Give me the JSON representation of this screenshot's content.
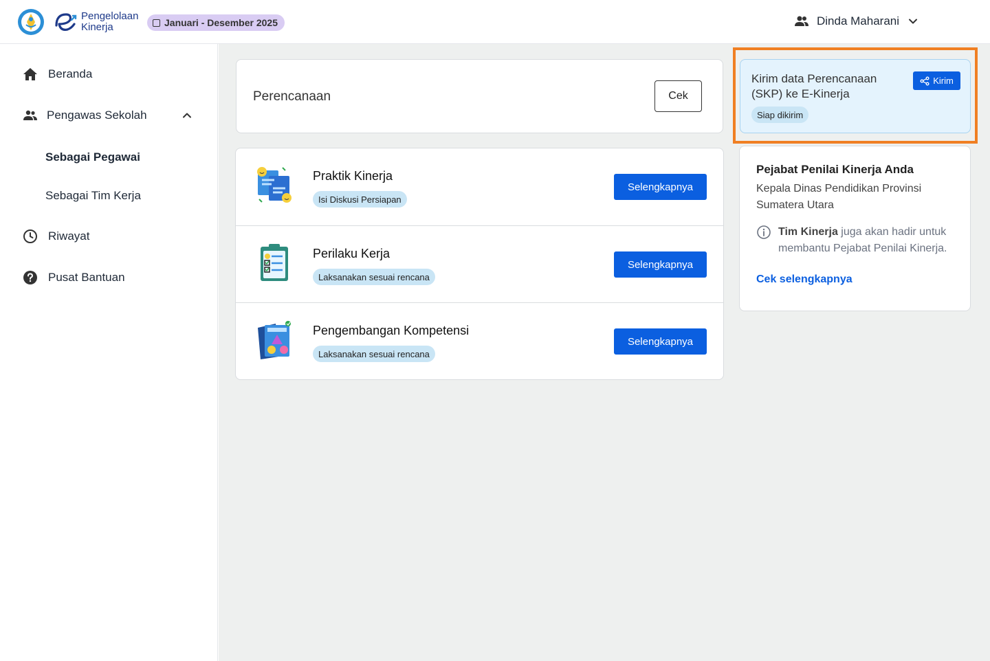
{
  "header": {
    "app_name_line1": "Pengelolaan",
    "app_name_line2": "Kinerja",
    "period": "Januari - Desember 2025",
    "user_name": "Dinda Maharani"
  },
  "sidebar": {
    "items": [
      {
        "label": "Beranda",
        "icon": "home-icon"
      },
      {
        "label": "Pengawas Sekolah",
        "icon": "people-icon",
        "expanded": true
      },
      {
        "label": "Sebagai Pegawai",
        "active": true
      },
      {
        "label": "Sebagai Tim Kerja"
      },
      {
        "label": "Riwayat",
        "icon": "clock-icon"
      },
      {
        "label": "Pusat Bantuan",
        "icon": "help-icon"
      }
    ]
  },
  "planning": {
    "title": "Perencanaan",
    "button": "Cek"
  },
  "activities": [
    {
      "title": "Praktik Kinerja",
      "status": "Isi Diskusi Persiapan",
      "button": "Selengkapnya",
      "icon": "praktik-kinerja-illustration"
    },
    {
      "title": "Perilaku Kerja",
      "status": "Laksanakan sesuai rencana",
      "button": "Selengkapnya",
      "icon": "clipboard-checklist-illustration"
    },
    {
      "title": "Pengembangan Kompetensi",
      "status": "Laksanakan sesuai rencana",
      "button": "Selengkapnya",
      "icon": "competency-book-illustration"
    }
  ],
  "send_card": {
    "title": "Kirim data Perencanaan (SKP) ke E-Kinerja",
    "status": "Siap dikirim",
    "button": "Kirim"
  },
  "assessor": {
    "title": "Pejabat Penilai Kinerja Anda",
    "description": "Kepala Dinas Pendidikan Provinsi Sumatera Utara",
    "info_bold": "Tim Kinerja",
    "info_rest": " juga akan hadir untuk membantu Pejabat Penilai Kinerja.",
    "link": "Cek selengkapnya"
  },
  "colors": {
    "primary": "#0b5fe0",
    "badge_bg": "#c9e5f5",
    "period_chip_bg": "#d9ccf3",
    "highlight_border": "#f07f23",
    "main_bg": "#eef0ef"
  }
}
